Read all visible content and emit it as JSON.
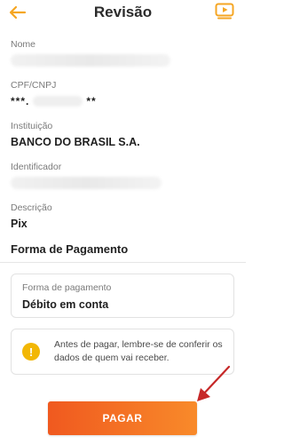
{
  "header": {
    "title": "Revisão",
    "back_icon": "arrow-left-icon",
    "video_icon": "play-video-icon",
    "accent_color": "#f5a623"
  },
  "fields": {
    "name": {
      "label": "Nome"
    },
    "document": {
      "label": "CPF/CNPJ",
      "masked_prefix": "***.",
      "masked_suffix": "**"
    },
    "institution": {
      "label": "Instituição",
      "value": "BANCO DO BRASIL S.A."
    },
    "identifier": {
      "label": "Identificador"
    },
    "description": {
      "label": "Descrição",
      "value": "Pix"
    }
  },
  "payment_section": {
    "title": "Forma de Pagamento",
    "method_label": "Forma de pagamento",
    "method_value": "Débito em conta"
  },
  "notice": {
    "icon": "exclamation-icon",
    "text": "Antes de pagar, lembre-se de conferir os dados de quem vai receber."
  },
  "action": {
    "pay_label": "PAGAR",
    "button_color": "#f26a22"
  },
  "annotation": {
    "arrow_color": "#c62828"
  }
}
